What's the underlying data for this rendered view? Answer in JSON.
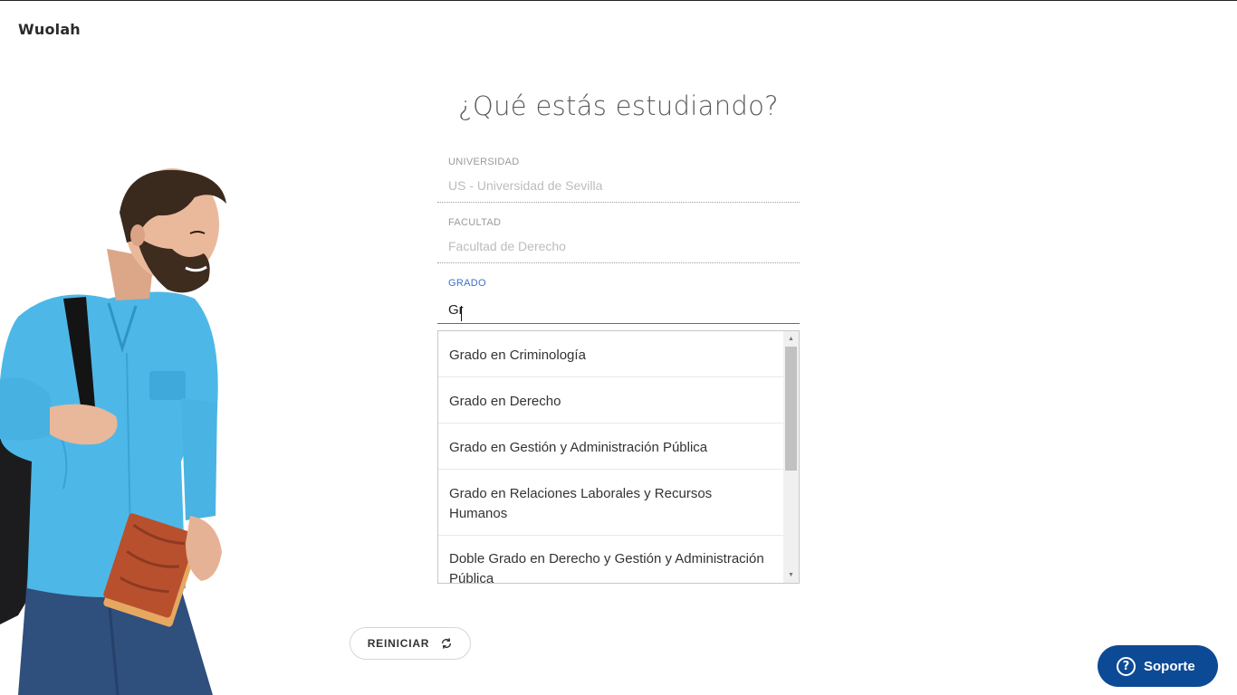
{
  "header": {
    "logo_text": "Wuolah"
  },
  "page": {
    "heading": "¿Qué estás estudiando?"
  },
  "form": {
    "universidad": {
      "label": "UNIVERSIDAD",
      "value": "US - Universidad de Sevilla"
    },
    "facultad": {
      "label": "FACULTAD",
      "value": "Facultad de Derecho"
    },
    "grado": {
      "label": "GRADO",
      "value": "Gr"
    }
  },
  "dropdown": {
    "items": [
      {
        "label": "Grado en Criminología"
      },
      {
        "label": "Grado en Derecho"
      },
      {
        "label": "Grado en Gestión y Administración Pública"
      },
      {
        "label": "Grado en Relaciones Laborales y Recursos Humanos"
      },
      {
        "label": "Doble Grado en Derecho y Gestión y Administración Pública"
      }
    ]
  },
  "actions": {
    "reset_label": "REINICIAR"
  },
  "support": {
    "label": "Soporte",
    "icon_glyph": "?"
  },
  "colors": {
    "accent_blue": "#3c6fd1",
    "support_blue": "#0d4a96",
    "shirt_blue": "#4db8e8"
  },
  "icons": {
    "reset": "refresh-icon",
    "support": "help-circle-icon",
    "scroll_up": "scroll-up-arrow-icon",
    "scroll_down": "scroll-down-arrow-icon"
  }
}
